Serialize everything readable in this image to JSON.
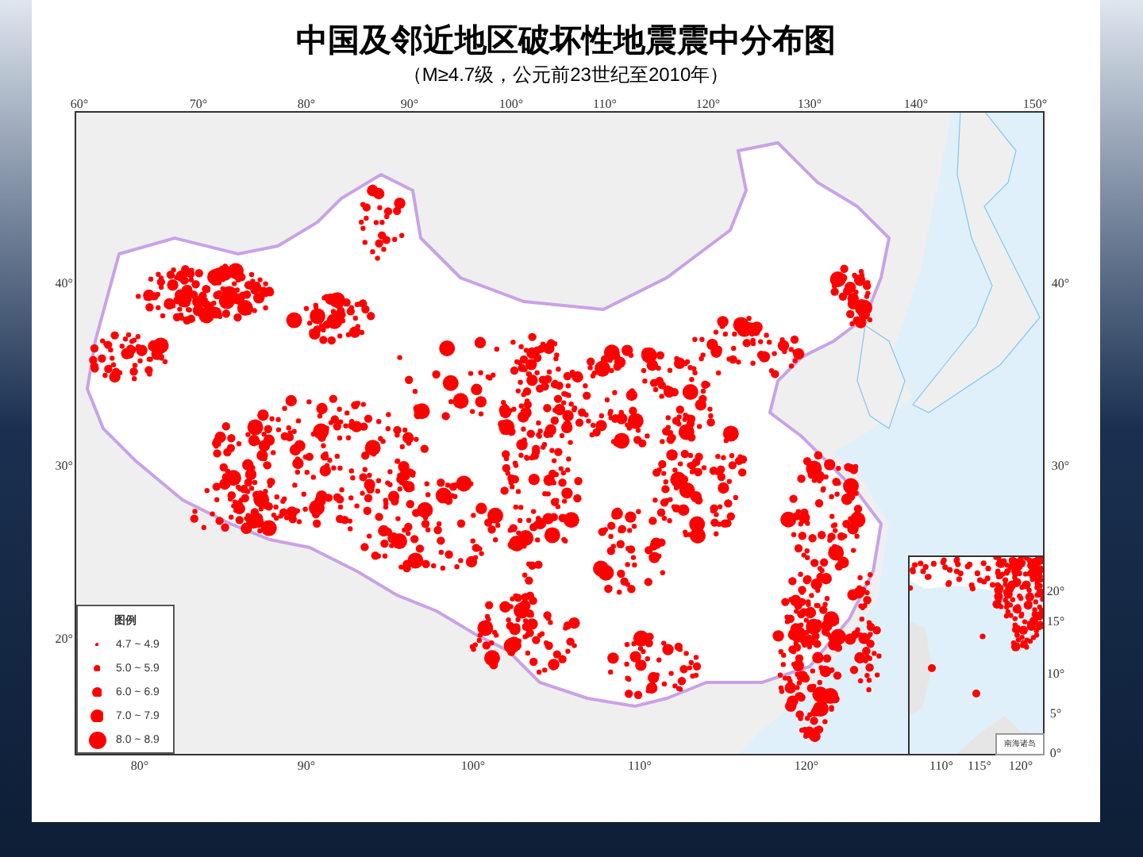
{
  "title": "中国及邻近地区破坏性地震震中分布图",
  "subtitle": "（M≥4.7级，公元前23世纪至2010年）",
  "map": {
    "top_ticks": [
      "60°",
      "70°",
      "80°",
      "90°",
      "100°",
      "110°",
      "120°",
      "130°",
      "140°",
      "150°"
    ],
    "bottom_ticks": [
      "80°",
      "90°",
      "100°",
      "110°",
      "120°"
    ],
    "left_ticks": [
      "40°",
      "30°",
      "20°"
    ],
    "right_ticks": [
      "40°",
      "30°"
    ]
  },
  "legend": {
    "title": "图例",
    "items": [
      {
        "label": "4.7 ~ 4.9"
      },
      {
        "label": "5.0 ~ 5.9"
      },
      {
        "label": "6.0 ~ 6.9"
      },
      {
        "label": "7.0 ~ 7.9"
      },
      {
        "label": "8.0 ~ 8.9"
      }
    ]
  },
  "inset": {
    "label": "南海诸岛",
    "bottom_ticks": [
      "110°",
      "115°",
      "120°"
    ],
    "right_ticks": [
      "20°",
      "15°",
      "10°",
      "5°",
      "0°"
    ]
  }
}
